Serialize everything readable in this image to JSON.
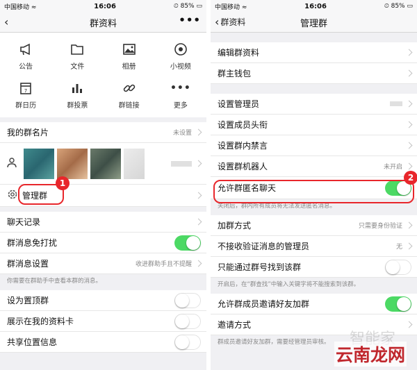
{
  "status": {
    "carrier": "中国移动",
    "time": "16:06",
    "battery": "85%"
  },
  "left": {
    "nav_title": "群资料",
    "grid": [
      {
        "label": "公告",
        "icon": "megaphone-icon"
      },
      {
        "label": "文件",
        "icon": "folder-icon"
      },
      {
        "label": "相册",
        "icon": "photo-icon"
      },
      {
        "label": "小视频",
        "icon": "video-icon"
      },
      {
        "label": "群日历",
        "icon": "calendar-icon"
      },
      {
        "label": "群投票",
        "icon": "vote-chart-icon"
      },
      {
        "label": "群链接",
        "icon": "link-icon"
      },
      {
        "label": "更多",
        "icon": "more-icon"
      }
    ],
    "card_label": "我的群名片",
    "card_value": "未设置",
    "manage_label": "管理群",
    "chat_history": "聊天记录",
    "mute_label": "群消息免打扰",
    "msg_settings_label": "群消息设置",
    "msg_settings_value": "收进群助手且不提醒",
    "msg_note": "你需要在群助手中查看本群的消息。",
    "pin_label": "设为置顶群",
    "show_card_label": "展示在我的资料卡",
    "share_location_label": "共享位置信息"
  },
  "right": {
    "back_label": "群资料",
    "nav_title": "管理群",
    "edit_info": "编辑群资料",
    "wallet": "群主钱包",
    "set_admin": "设置管理员",
    "set_member_title": "设置成员头衔",
    "set_mute": "设置群内禁言",
    "set_robot": "设置群机器人",
    "robot_value": "未开启",
    "anon_label": "允许群匿名聊天",
    "anon_note": "关闭后，群内所有成员将无法发送匿名消息。",
    "join_method": "加群方式",
    "join_value": "只需要身份验证",
    "no_verify_admin": "不接收验证消息的管理员",
    "no_verify_value": "无",
    "only_by_number": "只能通过群号找到该群",
    "search_note": "开启后，在“群查找”中输入关键字将不能搜索到该群。",
    "allow_invite": "允许群成员邀请好友加群",
    "invite_method": "邀请方式",
    "invite_note": "群成员邀请好友加群，需要经管理员审核。"
  },
  "annotations": {
    "badge1": "1",
    "badge2": "2"
  },
  "watermark": {
    "text": "云南龙网",
    "faint": "智能家"
  }
}
